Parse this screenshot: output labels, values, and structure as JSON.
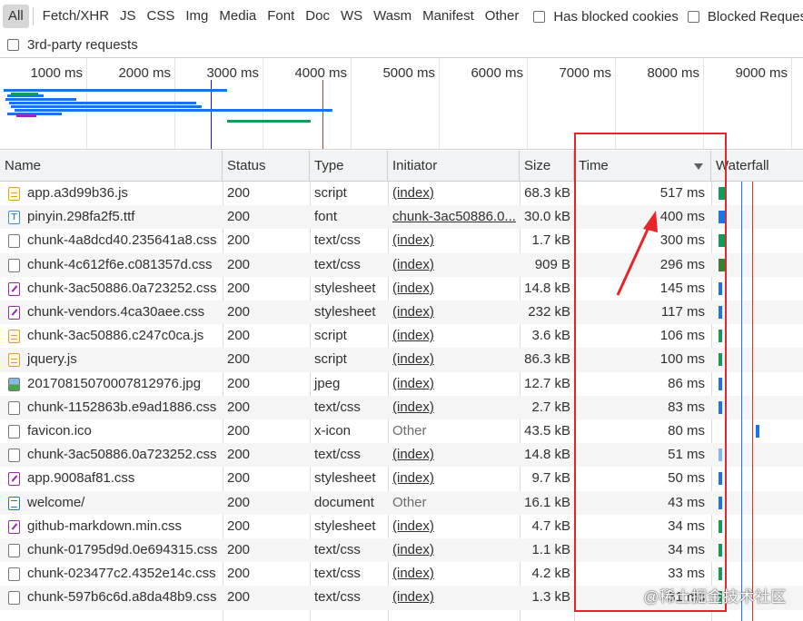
{
  "filter_bar": {
    "types": [
      "All",
      "Fetch/XHR",
      "JS",
      "CSS",
      "Img",
      "Media",
      "Font",
      "Doc",
      "WS",
      "Wasm",
      "Manifest",
      "Other"
    ],
    "active_type": "All",
    "checkboxes": {
      "has_blocked_cookies": "Has blocked cookies",
      "blocked_requests": "Blocked Requests",
      "third_party": "3rd-party requests"
    }
  },
  "overview": {
    "ticks": [
      "1000 ms",
      "2000 ms",
      "3000 ms",
      "4000 ms",
      "5000 ms",
      "6000 ms",
      "7000 ms",
      "8000 ms",
      "9000 ms"
    ],
    "dom_content_loaded_color": "#1a1aa6",
    "load_color": "#d93025"
  },
  "table": {
    "columns": {
      "name": "Name",
      "status": "Status",
      "type": "Type",
      "initiator": "Initiator",
      "size": "Size",
      "time": "Time",
      "waterfall": "Waterfall"
    },
    "sort_column": "Time",
    "sort_direction": "descending",
    "rows": [
      {
        "name": "app.a3d99b36.js",
        "status": "200",
        "type": "script",
        "initiator": "(index)",
        "size": "68.3 kB",
        "time": "517 ms",
        "icon": "script-icon"
      },
      {
        "name": "pinyin.298fa2f5.ttf",
        "status": "200",
        "type": "font",
        "initiator": "chunk-3ac50886.0...",
        "size": "30.0 kB",
        "time": "400 ms",
        "icon": "font-icon"
      },
      {
        "name": "chunk-4a8dcd40.235641a8.css",
        "status": "200",
        "type": "text/css",
        "initiator": "(index)",
        "size": "1.7 kB",
        "time": "300 ms",
        "icon": "document-icon"
      },
      {
        "name": "chunk-4c612f6e.c081357d.css",
        "status": "200",
        "type": "text/css",
        "initiator": "(index)",
        "size": "909 B",
        "time": "296 ms",
        "icon": "document-icon"
      },
      {
        "name": "chunk-3ac50886.0a723252.css",
        "status": "200",
        "type": "stylesheet",
        "initiator": "(index)",
        "size": "14.8 kB",
        "time": "145 ms",
        "icon": "stylesheet-icon"
      },
      {
        "name": "chunk-vendors.4ca30aee.css",
        "status": "200",
        "type": "stylesheet",
        "initiator": "(index)",
        "size": "232 kB",
        "time": "117 ms",
        "icon": "stylesheet-icon"
      },
      {
        "name": "chunk-3ac50886.c247c0ca.js",
        "status": "200",
        "type": "script",
        "initiator": "(index)",
        "size": "3.6 kB",
        "time": "106 ms",
        "icon": "script-icon"
      },
      {
        "name": "jquery.js",
        "status": "200",
        "type": "script",
        "initiator": "(index)",
        "size": "86.3 kB",
        "time": "100 ms",
        "icon": "script-icon"
      },
      {
        "name": "20170815070007812976.jpg",
        "status": "200",
        "type": "jpeg",
        "initiator": "(index)",
        "size": "12.7 kB",
        "time": "86 ms",
        "icon": "image-icon"
      },
      {
        "name": "chunk-1152863b.e9ad1886.css",
        "status": "200",
        "type": "text/css",
        "initiator": "(index)",
        "size": "2.7 kB",
        "time": "83 ms",
        "icon": "document-icon"
      },
      {
        "name": "favicon.ico",
        "status": "200",
        "type": "x-icon",
        "initiator": "Other",
        "size": "43.5 kB",
        "time": "80 ms",
        "icon": "document-icon"
      },
      {
        "name": "chunk-3ac50886.0a723252.css",
        "status": "200",
        "type": "text/css",
        "initiator": "(index)",
        "size": "14.8 kB",
        "time": "51 ms",
        "icon": "document-icon"
      },
      {
        "name": "app.9008af81.css",
        "status": "200",
        "type": "stylesheet",
        "initiator": "(index)",
        "size": "9.7 kB",
        "time": "50 ms",
        "icon": "stylesheet-icon"
      },
      {
        "name": "welcome/",
        "status": "200",
        "type": "document",
        "initiator": "Other",
        "size": "16.1 kB",
        "time": "43 ms",
        "icon": "html-document-icon"
      },
      {
        "name": "github-markdown.min.css",
        "status": "200",
        "type": "stylesheet",
        "initiator": "(index)",
        "size": "4.7 kB",
        "time": "34 ms",
        "icon": "stylesheet-icon"
      },
      {
        "name": "chunk-01795d9d.0e694315.css",
        "status": "200",
        "type": "text/css",
        "initiator": "(index)",
        "size": "1.1 kB",
        "time": "34 ms",
        "icon": "document-icon"
      },
      {
        "name": "chunk-023477c2.4352e14c.css",
        "status": "200",
        "type": "text/css",
        "initiator": "(index)",
        "size": "4.2 kB",
        "time": "33 ms",
        "icon": "document-icon"
      },
      {
        "name": "chunk-597b6c6d.a8da48b9.css",
        "status": "200",
        "type": "text/css",
        "initiator": "(index)",
        "size": "1.3 kB",
        "time": "31 ms",
        "icon": "document-icon"
      }
    ]
  },
  "watermark": "@稀土掘金技术社区",
  "colors": {
    "annotation_red": "#e5252a",
    "waterfall_blue": "#1a73e8",
    "waterfall_green": "#0f9d58"
  }
}
